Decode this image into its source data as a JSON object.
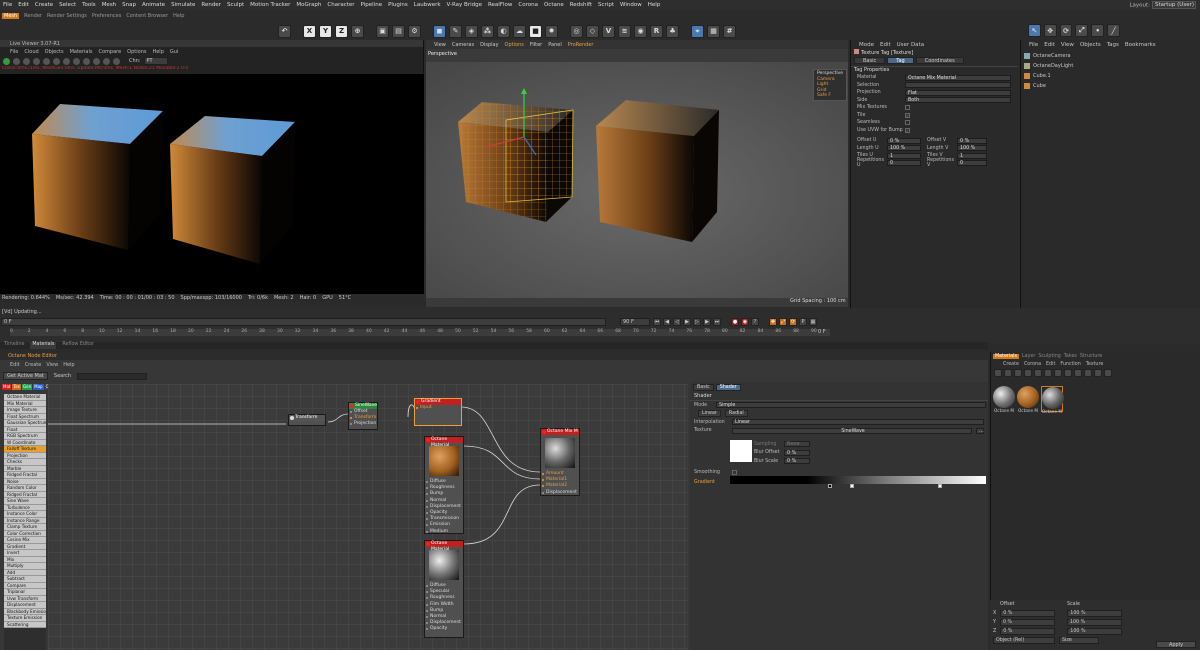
{
  "menubar": {
    "items": [
      "File",
      "Edit",
      "Create",
      "Select",
      "Tools",
      "Mesh",
      "Snap",
      "Animate",
      "Simulate",
      "Render",
      "Sculpt",
      "Motion Tracker",
      "MoGraph",
      "Character",
      "Pipeline",
      "Plugins",
      "Laubwerk",
      "V-Ray Bridge",
      "RealFlow",
      "Corona",
      "Octane",
      "Redshift",
      "Script",
      "Window",
      "Help"
    ],
    "layout_label": "Layout:",
    "layout_value": "Startup (User)"
  },
  "subbar": {
    "items": [
      "Mesh",
      "Render",
      "Render Settings",
      "Preferences",
      "Content Browser",
      "Help"
    ]
  },
  "toolbar": {
    "xyz": [
      "X",
      "Y",
      "Z"
    ]
  },
  "liveviewer": {
    "title": "Live Viewer 3.07-R1",
    "menu": [
      "File",
      "Cloud",
      "Objects",
      "Materials",
      "Compare",
      "Options",
      "Help",
      "Gui"
    ],
    "chn_label": "Chn:",
    "chn_value": "PT",
    "error": "Check:0ms./1ms. MeshGen:0ms. Update:M0:0ms. Mesh:1 Nodes:21 Movable:2  0:0",
    "status": [
      "Rendering: 0.644%",
      "Ms/sec: 42.394",
      "Time: 00 : 00 : 01/00 : 03 : 50",
      "Spp/maxspp: 103/16000",
      "Tri: 0/6k",
      "Mesh: 2",
      "Hair: 0",
      "GPU",
      "51°C"
    ]
  },
  "viewport": {
    "menu": [
      "View",
      "Cameras",
      "Display",
      "Options",
      "Filter",
      "Panel",
      "ProRender"
    ],
    "label": "Perspective",
    "grid": "Grid Spacing : 100 cm",
    "persp_items": [
      "Perspective",
      "Camera",
      "Light",
      "Grid",
      "Safe F"
    ]
  },
  "attributes": {
    "menu": [
      "Mode",
      "Edit",
      "User Data"
    ],
    "header": "Texture Tag [Texture]",
    "tabs": [
      "Basic",
      "Tag",
      "Coordinates"
    ],
    "section": "Tag Properties",
    "props": [
      {
        "label": "Material",
        "value": "Octane Mix Material"
      },
      {
        "label": "Selection",
        "value": ""
      },
      {
        "label": "Projection",
        "value": "Flat"
      },
      {
        "label": "Side",
        "value": "Both"
      }
    ],
    "checks": [
      {
        "label": "Mix Textures",
        "value": ""
      },
      {
        "label": "Tile",
        "value": "✓"
      },
      {
        "label": "Seamless",
        "value": ""
      },
      {
        "label": "Use UVW for Bump",
        "value": "✓"
      }
    ],
    "offsets": [
      {
        "l": "Offset U",
        "v": "0 %",
        "l2": "Offset V",
        "v2": "0 %"
      },
      {
        "l": "Length U",
        "v": "100 %",
        "l2": "Length V",
        "v2": "100 %"
      },
      {
        "l": "Tiles U",
        "v": "1",
        "l2": "Tiles V",
        "v2": "1"
      },
      {
        "l": "Repetitions U",
        "v": "0",
        "l2": "Repetitions V",
        "v2": "0"
      }
    ]
  },
  "objects": {
    "menu": [
      "File",
      "Edit",
      "View",
      "Objects",
      "Tags",
      "Bookmarks"
    ],
    "items": [
      "OctaneCamera",
      "OctaneDayLight",
      "Cube.1",
      "Cube"
    ]
  },
  "timeline": {
    "frame_start": "0 F",
    "frame_end": "90 F",
    "ticks": [
      "0",
      "2",
      "4",
      "6",
      "8",
      "10",
      "12",
      "14",
      "16",
      "18",
      "20",
      "22",
      "24",
      "26",
      "28",
      "30",
      "32",
      "34",
      "36",
      "38",
      "40",
      "42",
      "44",
      "46",
      "48",
      "50",
      "52",
      "54",
      "56",
      "58",
      "60",
      "62",
      "64",
      "66",
      "68",
      "70",
      "72",
      "74",
      "76",
      "78",
      "80",
      "82",
      "84",
      "86",
      "88",
      "90"
    ],
    "updating": "[Vd]  Updating...",
    "end_field": "0 F"
  },
  "bottom_tabs": [
    "Timeline",
    "Materials",
    "Reflow Editor"
  ],
  "nodeeditor": {
    "title": "Octane Node Editor",
    "menu": [
      "Edit",
      "Create",
      "View",
      "Help"
    ],
    "getmat": "Get Active Mat",
    "search": "Search",
    "swatches": [
      {
        "t": "Mat",
        "c": "#d02020"
      },
      {
        "t": "Tex",
        "c": "#d06a20"
      },
      {
        "t": "Gen",
        "c": "#20a050"
      },
      {
        "t": "Map",
        "c": "#2060d0"
      },
      {
        "t": "Oth",
        "c": "#404040"
      },
      {
        "t": "Ems",
        "c": "#8040b0"
      },
      {
        "t": "Med",
        "c": "#20a0a0"
      },
      {
        "t": "C4D",
        "c": "#777"
      }
    ],
    "list": [
      "Octane Material",
      "Mix Material",
      "Image Texture",
      "Float Spectrum",
      "Gaussian Spectrum",
      "Float",
      "RGB Spectrum",
      "W Coordinate",
      "Falloff Texture",
      "Projection",
      "Checks",
      "Marble",
      "Ridged Fractal",
      "Noise",
      "Random Color",
      "Ridged Fractal",
      "Sine Wave",
      "Turbulence",
      "Instance Color",
      "Instance Range",
      "Clamp Texture",
      "Color Correction",
      "Cosine Mix",
      "Gradient",
      "Invert",
      "Mix",
      "Multiply",
      "Add",
      "Subtract",
      "Compare",
      "Triplanar",
      "Uvw Transform",
      "Displacement",
      "Blackbody Emission",
      "Texture Emission",
      "Scattering"
    ],
    "transform": "Transform",
    "sinewave": {
      "title": "SineWave",
      "pins": [
        "Offset",
        "Transform",
        "Projection"
      ]
    },
    "gradient": {
      "title": "Gradient",
      "pins": [
        "Input"
      ]
    },
    "mat1": {
      "title": "Octane Material",
      "pins": [
        "Diffuse",
        "Roughness",
        "Bump",
        "Normal",
        "Displacement",
        "Opacity",
        "Transmission",
        "Emission",
        "Medium"
      ]
    },
    "mat2": {
      "title": "Octane Material",
      "pins": [
        "Diffuse",
        "Specular",
        "Roughness",
        "Film Width",
        "Bump",
        "Normal",
        "Displacement",
        "Opacity"
      ]
    },
    "mix": {
      "title": "Octane Mix M",
      "pins": [
        "Amount",
        "Material1",
        "Material2",
        "Displacement"
      ]
    }
  },
  "inspector": {
    "tabs": [
      "Basic",
      "Shader"
    ],
    "section": "Shader",
    "mode_label": "Mode",
    "mode": "Simple",
    "btns": [
      "Linear",
      "Radial"
    ],
    "interp_label": "Interpolation",
    "interp": "Linear",
    "texture_label": "Texture",
    "texture": "SineWave",
    "sampling_label": "Sampling",
    "sampling": "None",
    "blur_offset_label": "Blur Offset",
    "blur_offset": "0 %",
    "blur_scale_label": "Blur Scale",
    "blur_scale": "0 %",
    "smoothing_label": "Smoothing",
    "gradient_label": "Gradient"
  },
  "materials": {
    "tabs": [
      "Materials",
      "Layer",
      "Sculpting",
      "Takes",
      "Structure"
    ],
    "menu": [
      "Create",
      "Corona",
      "Edit",
      "Function",
      "Texture"
    ],
    "items": [
      "Octane M",
      "Octane M",
      "Octane M"
    ]
  },
  "coords": {
    "headers": [
      "Position",
      "Offset",
      "Scale"
    ],
    "rows": [
      {
        "a": "X",
        "v": "0 %",
        "b": "100 %"
      },
      {
        "a": "Y",
        "v": "0 %",
        "b": "100 %"
      },
      {
        "a": "Z",
        "v": "0 %",
        "b": "100 %"
      }
    ],
    "mode": "Object (Rel)",
    "size": "Size",
    "apply": "Apply"
  }
}
